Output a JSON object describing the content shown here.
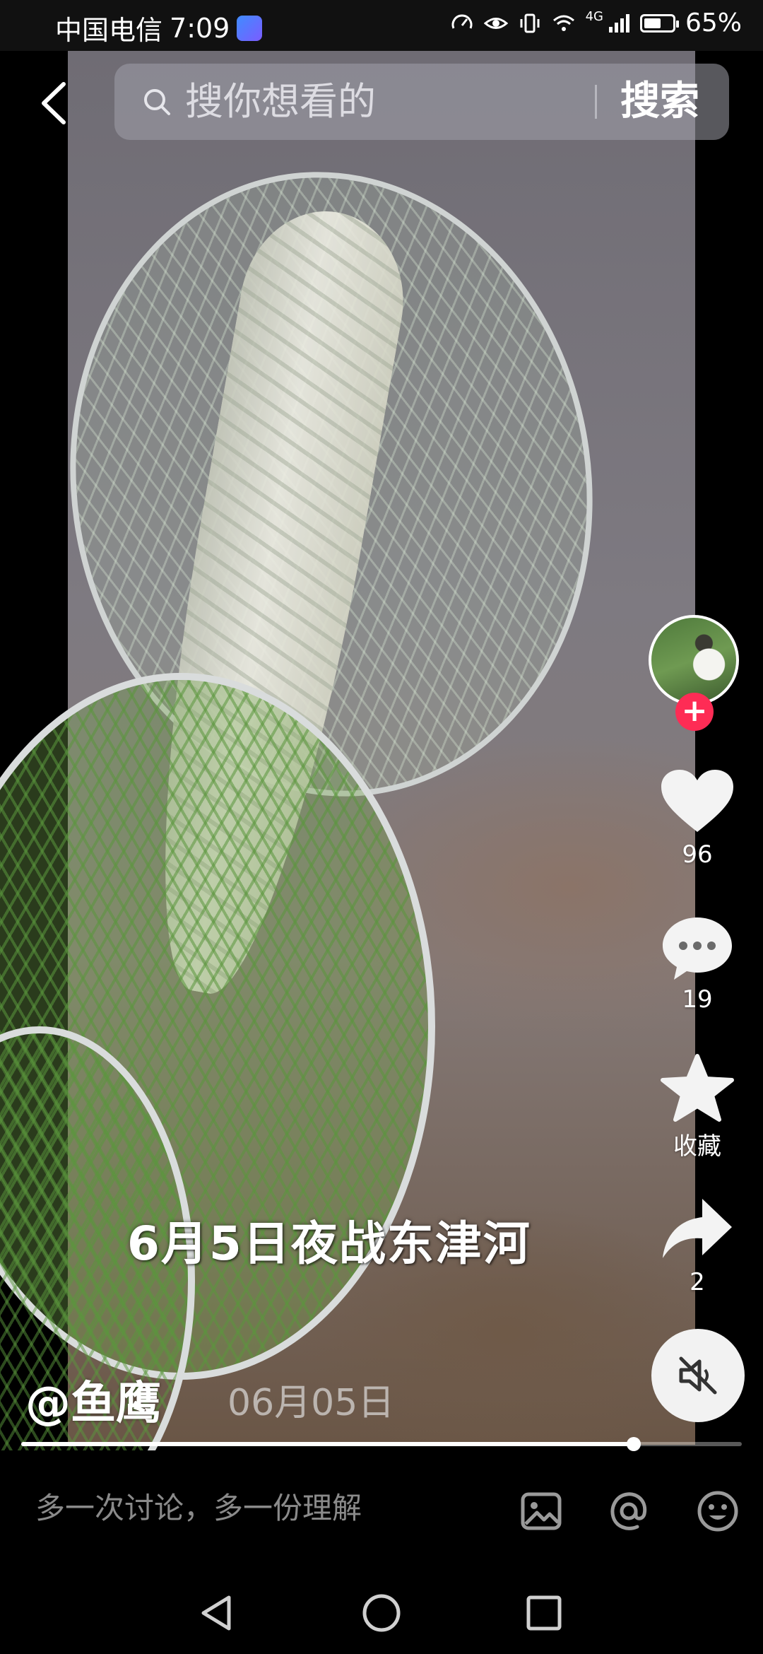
{
  "status_bar": {
    "carrier": "中国电信",
    "time": "7:09",
    "network": "4G",
    "battery_percent": "65%",
    "battery_level": 0.65,
    "icons": [
      "speedometer-icon",
      "eye-icon",
      "vibrate-icon",
      "wifi-icon",
      "signal-icon",
      "battery-icon"
    ]
  },
  "search": {
    "placeholder": "搜你想看的",
    "button_label": "搜索"
  },
  "video": {
    "caption": "6月5日夜战东津河",
    "author": "@鱼鹰",
    "date": "06月05日",
    "progress": 0.85
  },
  "actions": {
    "follow_label": "+",
    "likes": "96",
    "comments": "19",
    "favorite_label": "收藏",
    "shares": "2"
  },
  "comment_bar": {
    "placeholder": "多一次讨论，多一份理解"
  },
  "colors": {
    "accent": "#fe2c55",
    "background": "#000000",
    "secondary_text": "#8a8a8a"
  }
}
